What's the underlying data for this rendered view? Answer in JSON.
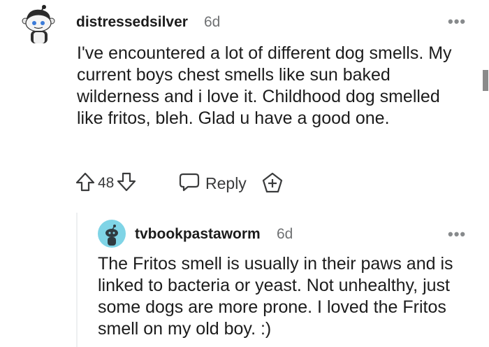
{
  "comment": {
    "username": "distressedsilver",
    "age": "6d",
    "more_label": "•••",
    "body": "I've encountered a lot of different dog smells. My current boys chest smells like sun baked wilderness and i love it. Childhood dog smelled like fritos, bleh. Glad u have a good one.",
    "vote_count": "48",
    "reply_label": "Reply"
  },
  "reply": {
    "username": "tvbookpastaworm",
    "age": "6d",
    "more_label": "•••",
    "body": "The Fritos smell is usually in their paws and is linked to bacteria or yeast. Not unhealthy, just some dogs are more prone. I loved the Fritos smell on my old boy. :)"
  },
  "icons": {
    "upvote": "upvote-arrow-icon",
    "downvote": "downvote-arrow-icon",
    "reply": "speech-bubble-icon",
    "award": "award-plus-icon"
  },
  "colors": {
    "text": "#1c1c1c",
    "meta": "#6f7173",
    "icon": "#3a3b3c",
    "reply_avatar_bg": "#7fd4e6"
  }
}
